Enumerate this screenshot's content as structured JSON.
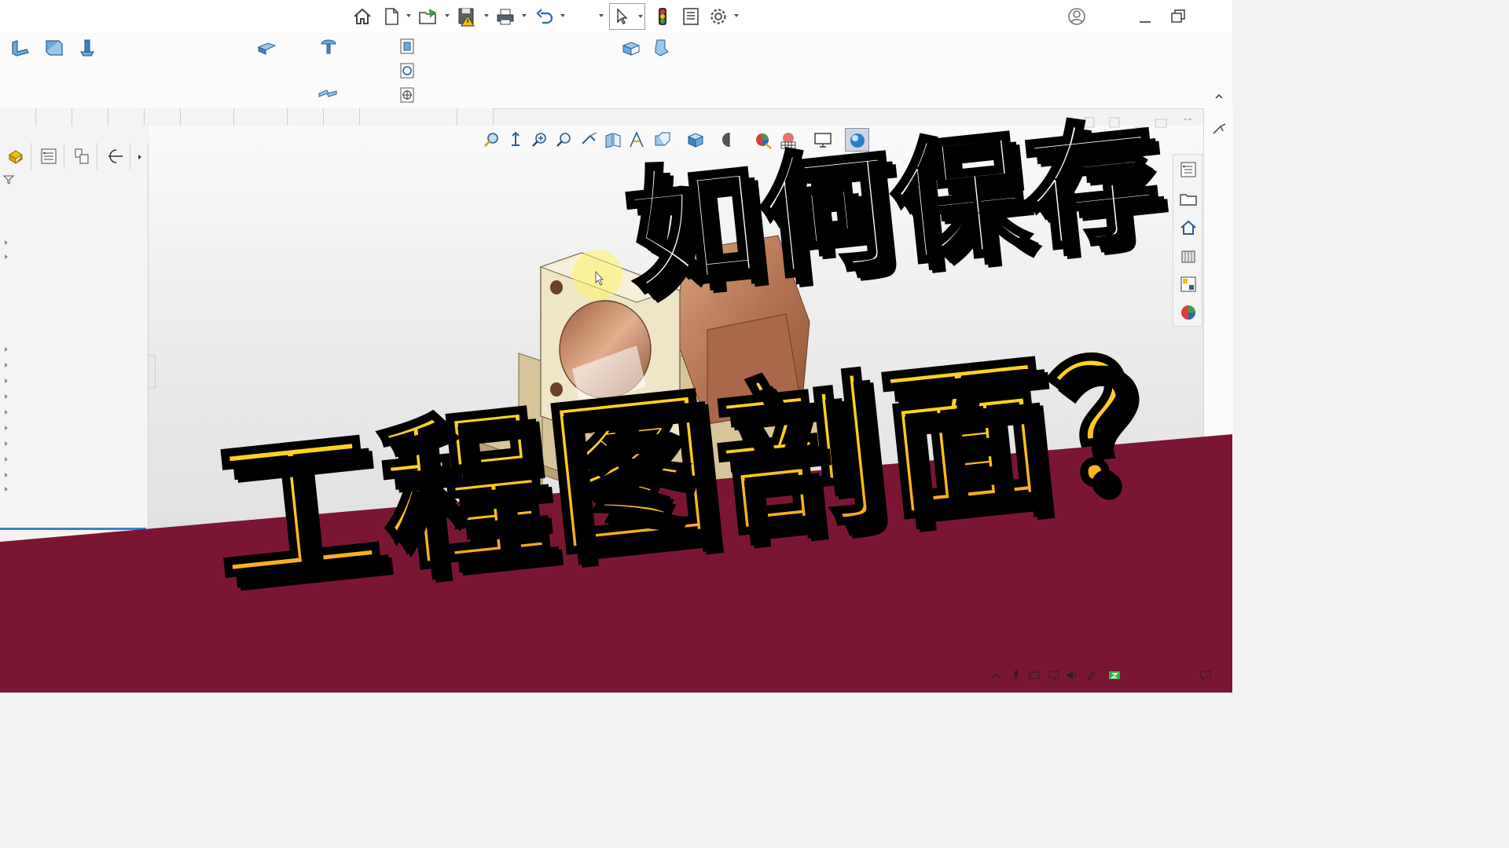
{
  "headline": {
    "line1": "如何保存",
    "line2": "工程图剖面？"
  },
  "titlebar": {
    "icons": [
      "home-icon",
      "new-file-icon",
      "open-icon",
      "save-icon",
      "print-icon",
      "undo-icon",
      "select-arrow-icon",
      "traffic-light-icon",
      "file-properties-icon",
      "gear-icon",
      "user-account-icon",
      "minimize-icon",
      "restore-icon"
    ]
  },
  "ribbon": {
    "icons": [
      "sheet-metal-icon",
      "base-flange-icon",
      "extrude-boss-icon",
      "edge-flange-icon",
      "hole-wizard-icon",
      "section-view-icon",
      "detail-view-icon",
      "crop-view-icon",
      "unfold-icon",
      "fold-icon",
      "jog-icon"
    ]
  },
  "feature_panel": {
    "tabs": [
      "feature-manager-icon",
      "property-manager-icon",
      "configuration-manager-icon",
      "dimxpert-icon"
    ]
  },
  "view_toolbar": {
    "icons": [
      "zoom-to-fit-icon",
      "zoom-to-area-icon",
      "zoom-in-out-icon",
      "zoom-selection-icon",
      "rotate-icon",
      "section-view-icon",
      "dynamic-annotation-icon",
      "previous-view-icon",
      "view-orientation-icon",
      "display-style-icon",
      "hide-show-icon",
      "edit-appearance-icon",
      "apply-scene-icon",
      "display-settings-icon",
      "realview-icon"
    ]
  },
  "task_pane": {
    "icons": [
      "design-library-icon",
      "file-explorer-icon",
      "resources-icon",
      "view-palette-icon",
      "custom-properties-icon",
      "appearances-icon"
    ]
  },
  "colors": {
    "banner": "#7a1634",
    "headline_white": "#ffffff",
    "headline_yellow": "#ffd21f",
    "headline_orange": "#f7a21c",
    "part_face": "#efe6c8",
    "part_copper": "#c08a66"
  }
}
